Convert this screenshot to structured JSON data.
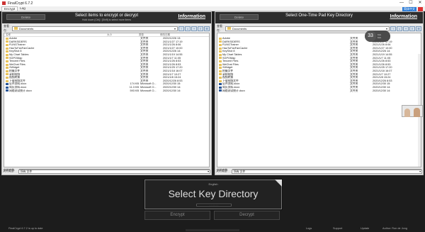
{
  "window": {
    "title": "FinalCrypt 6.7.2",
    "minimize": "—",
    "maximize": "☐",
    "close": "✕"
  },
  "tabs": [
    {
      "label": "Encrypt"
    },
    {
      "label": "Log"
    }
  ],
  "language_button": "简体中文",
  "left": {
    "button": "Delete",
    "title": "Select items to encrypt or decrypt",
    "subtitle": "Hold down [Ctrl] / [Shift] to select more items",
    "info": "Information",
    "path_label": "查看在:",
    "path": "Documents",
    "filename_label": "文件名称:",
    "filetype_label": "文件类型:",
    "filetype": "所有 文件",
    "columns": [
      "名称",
      "大小",
      "类型",
      "修改日期"
    ],
    "files": [
      {
        "name": "Adobe",
        "size": "",
        "type": "文件夹",
        "date": "2020/12/26 13:",
        "icon": "folder"
      },
      {
        "name": "DARKSIDERS",
        "size": "",
        "type": "文件夹",
        "date": "2021/1/27 17:19",
        "icon": "folder"
      },
      {
        "name": "FLiNGTrainer",
        "size": "",
        "type": "文件夹",
        "date": "2021/1/26 8:06",
        "icon": "folder"
      },
      {
        "name": "HaoTuFanFanCache",
        "size": "",
        "type": "文件夹",
        "date": "2021/1/27 10:00",
        "icon": "folder"
      },
      {
        "name": "KeyShot 8",
        "size": "",
        "type": "文件夹",
        "date": "2020/12/26 14:",
        "icon": "folder"
      },
      {
        "name": "My Chart Tables",
        "size": "",
        "type": "文件夹",
        "date": "2021/1/19 14:55",
        "icon": "folder"
      },
      {
        "name": "SGPOMap",
        "size": "",
        "type": "文件夹",
        "date": "2021/1/7 11:05",
        "icon": "folder"
      },
      {
        "name": "Tencent Files",
        "size": "",
        "type": "文件夹",
        "date": "2021/1/26 8:53",
        "icon": "folder"
      },
      {
        "name": "WeChat Files",
        "size": "",
        "type": "文件夹",
        "date": "2021/1/26 8:53",
        "icon": "folder"
      },
      {
        "name": "XWidget",
        "size": "",
        "type": "文件夹",
        "date": "2021/1/25 17:20",
        "icon": "folder"
      },
      {
        "name": "拍摄文件",
        "size": "",
        "type": "文件夹",
        "date": "2021/1/18 16:07",
        "icon": "folder"
      },
      {
        "name": "录制视频",
        "size": "",
        "type": "文件夹",
        "date": "2021/1/7 10:27",
        "icon": "folder"
      },
      {
        "name": "视频转换",
        "size": "",
        "type": "文件夹",
        "date": "2021/1/8 15:24",
        "icon": "folder"
      },
      {
        "name": "下载视频文件",
        "size": "",
        "type": "文件夹",
        "date": "2020/12/26 8:53",
        "icon": "folder"
      },
      {
        "name": "证件资料.docx",
        "size": "174 KB",
        "type": "Microsoft O...",
        "date": "2020/12/30 15:",
        "icon": "doc"
      },
      {
        "name": "简历资料.docx",
        "size": "11.3 KB",
        "type": "Microsoft O...",
        "date": "2020/12/30 14:",
        "icon": "doc"
      },
      {
        "name": "网络测试统计.docx",
        "size": "593 KB",
        "type": "Microsoft O...",
        "date": "2020/12/30 14:",
        "icon": "doc"
      }
    ]
  },
  "right": {
    "button": "Delete",
    "title": "Select One-Time Pad Key Directory",
    "info": "Information",
    "path_label": "查看在:",
    "path": "Documents",
    "filename_label": "文件名称:",
    "filetype_label": "文件类型:",
    "filetype": "所有 文件",
    "files": [
      {
        "name": "Adobe",
        "type": "文件夹",
        "date": "2020/12/26 13:",
        "icon": "folder"
      },
      {
        "name": "DARKSIDERS",
        "type": "文件夹",
        "date": "2021/1/27 17:19",
        "icon": "folder"
      },
      {
        "name": "FLiNGTrainer",
        "type": "文件夹",
        "date": "2021/1/26 8:06",
        "icon": "folder"
      },
      {
        "name": "HaoTuFanFanCache",
        "type": "文件夹",
        "date": "2021/1/27 10:00",
        "icon": "folder"
      },
      {
        "name": "KeyShot 8",
        "type": "文件夹",
        "date": "2020/12/26 14:",
        "icon": "folder"
      },
      {
        "name": "My Chart Tables",
        "type": "文件夹",
        "date": "2021/1/19 14:55",
        "icon": "folder"
      },
      {
        "name": "SGPOMap",
        "type": "文件夹",
        "date": "2021/1/7 11:05",
        "icon": "folder"
      },
      {
        "name": "Tencent Files",
        "type": "文件夹",
        "date": "2021/1/26 8:53",
        "icon": "folder"
      },
      {
        "name": "WeChat Files",
        "type": "文件夹",
        "date": "2021/1/26 8:53",
        "icon": "folder"
      },
      {
        "name": "XWidget",
        "type": "文件夹",
        "date": "2021/1/25 17:20",
        "icon": "folder"
      },
      {
        "name": "拍摄文件",
        "type": "文件夹",
        "date": "2021/1/18 16:07",
        "icon": "folder"
      },
      {
        "name": "录制视频",
        "type": "文件夹",
        "date": "2021/1/7 10:27",
        "icon": "folder"
      },
      {
        "name": "视频转换",
        "type": "文件夹",
        "date": "2021/1/8 15:24",
        "icon": "folder"
      },
      {
        "name": "下载视频文件",
        "type": "文件夹",
        "date": "2020/12/26 8:53",
        "icon": "folder"
      },
      {
        "name": "证件资料.docx",
        "type": "文件夹",
        "date": "2020/12/30 15:",
        "icon": "doc"
      },
      {
        "name": "简历资料.docx",
        "type": "文件夹",
        "date": "2020/12/30 14:",
        "icon": "doc"
      },
      {
        "name": "网络测试统计.docx",
        "type": "文件夹",
        "date": "2020/12/30 14:",
        "icon": "doc"
      }
    ]
  },
  "key_panel": {
    "language": "English",
    "title": "Select Key Directory"
  },
  "encrypt_button": "Encrypt",
  "decrypt_button": "Decrypt",
  "status": {
    "version": "FinalCrypt 6.7.2 is up to date",
    "logs": "Logs",
    "support": "Support",
    "update": "Update",
    "author": "Author: Ron de Jong"
  },
  "overlay": {
    "count": "33",
    "line1": "Ki/s",
    "line2": "Ki/s"
  },
  "colors": {
    "accent": "#2b7bd6",
    "folder": "#e8c35c",
    "doc": "#2b5797"
  }
}
